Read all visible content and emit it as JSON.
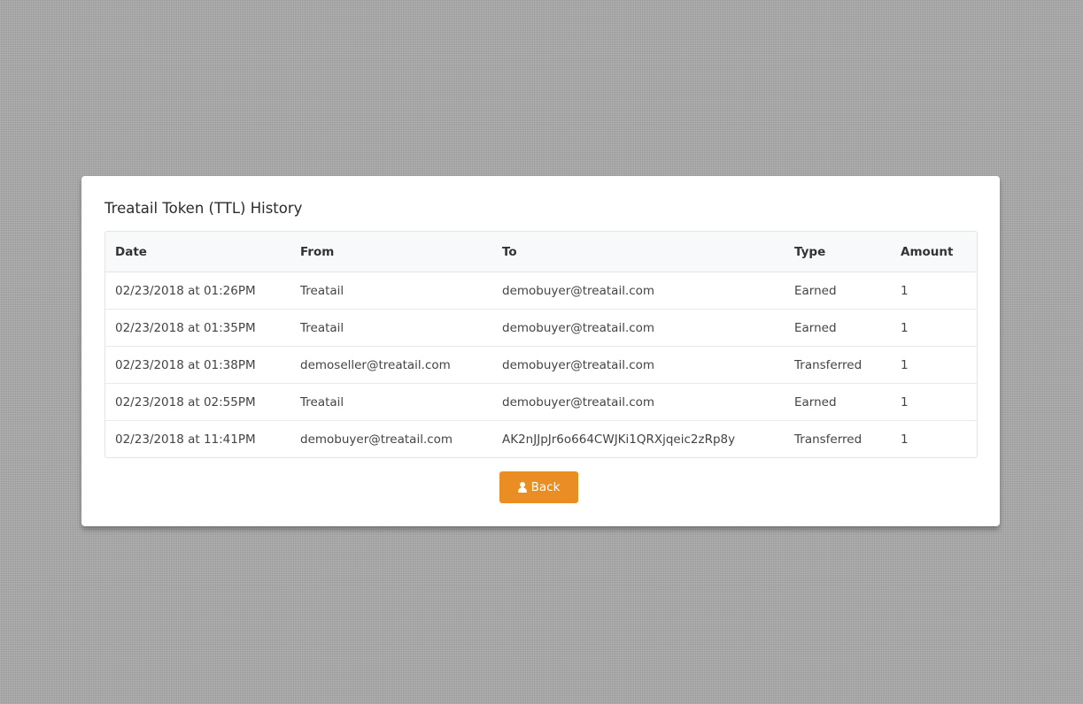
{
  "card": {
    "title": "Treatail Token (TTL) History"
  },
  "table": {
    "headers": {
      "date": "Date",
      "from": "From",
      "to": "To",
      "type": "Type",
      "amount": "Amount"
    },
    "rows": [
      {
        "date": "02/23/2018 at 01:26PM",
        "from": "Treatail",
        "to": "demobuyer@treatail.com",
        "type": "Earned",
        "amount": "1"
      },
      {
        "date": "02/23/2018 at 01:35PM",
        "from": "Treatail",
        "to": "demobuyer@treatail.com",
        "type": "Earned",
        "amount": "1"
      },
      {
        "date": "02/23/2018 at 01:38PM",
        "from": "demoseller@treatail.com",
        "to": "demobuyer@treatail.com",
        "type": "Transferred",
        "amount": "1"
      },
      {
        "date": "02/23/2018 at 02:55PM",
        "from": "Treatail",
        "to": "demobuyer@treatail.com",
        "type": "Earned",
        "amount": "1"
      },
      {
        "date": "02/23/2018 at 11:41PM",
        "from": "demobuyer@treatail.com",
        "to": "AK2nJJpJr6o664CWJKi1QRXjqeic2zRp8y",
        "type": "Transferred",
        "amount": "1"
      }
    ]
  },
  "back_button": {
    "label": "Back",
    "icon": "user-icon",
    "color": "#ea8d23"
  }
}
